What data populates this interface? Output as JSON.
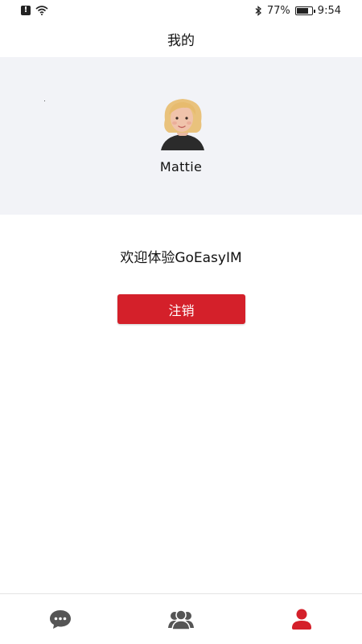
{
  "status_bar": {
    "battery": "77%",
    "time": "9:54",
    "alert": "!"
  },
  "header": {
    "title": "我的"
  },
  "profile": {
    "name": "Mattie"
  },
  "welcome": "欢迎体验GoEasyIM",
  "logout_label": "注销",
  "tabs": [
    {
      "icon": "chat-bubble-icon",
      "active": false
    },
    {
      "icon": "contacts-icon",
      "active": false
    },
    {
      "icon": "user-icon",
      "active": true
    }
  ],
  "colors": {
    "accent": "#d4202a",
    "inactive_icon": "#555555",
    "profile_bg": "#f2f3f7"
  }
}
